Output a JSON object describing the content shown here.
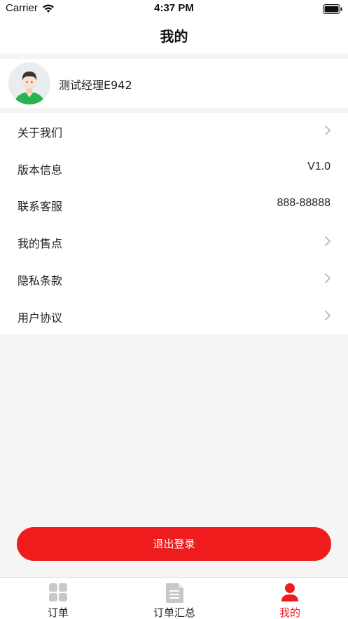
{
  "status_bar": {
    "carrier": "Carrier",
    "time": "4:37 PM"
  },
  "nav": {
    "title": "我的"
  },
  "profile": {
    "username": "测试经理E942"
  },
  "menu": {
    "items": [
      {
        "label": "关于我们",
        "value": "",
        "chevron": true
      },
      {
        "label": "版本信息",
        "value": "V1.0",
        "chevron": false
      },
      {
        "label": "联系客服",
        "value": "888-88888",
        "chevron": false
      },
      {
        "label": "我的售点",
        "value": "",
        "chevron": true
      },
      {
        "label": "隐私条款",
        "value": "",
        "chevron": true
      },
      {
        "label": "用户协议",
        "value": "",
        "chevron": true
      }
    ]
  },
  "logout": {
    "label": "退出登录"
  },
  "tabbar": {
    "tabs": [
      {
        "label": "订单",
        "icon": "grid-icon",
        "active": false
      },
      {
        "label": "订单汇总",
        "icon": "document-icon",
        "active": false
      },
      {
        "label": "我的",
        "icon": "user-icon",
        "active": true
      }
    ]
  },
  "colors": {
    "accent": "#ee1c1c",
    "background": "#f5f5f5",
    "inactive_icon": "#c8c8c8"
  }
}
